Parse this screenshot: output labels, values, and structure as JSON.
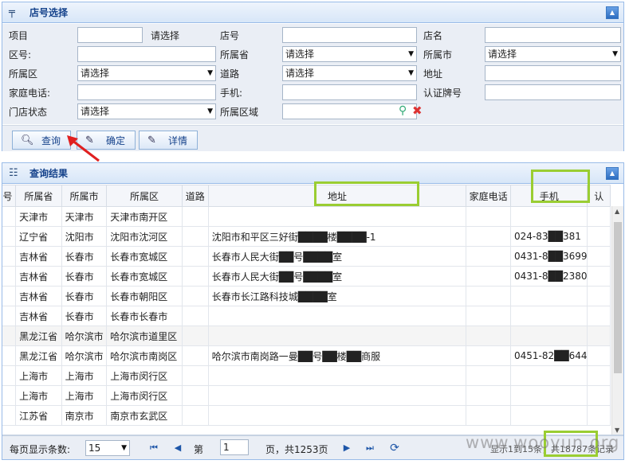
{
  "search_panel": {
    "title": "店号选择",
    "collapse": "▲",
    "fields": {
      "xiangmu_label": "项目",
      "xiangmu_value": "",
      "xiangmu_hint": "请选择",
      "dianhao_label": "店号",
      "dianming_label": "店名",
      "quhao_label": "区号:",
      "suoshusheng_label": "所属省",
      "suoshusheng_value": "请选择",
      "suoshushi_label": "所属市",
      "suoshushi_value": "请选择",
      "suoshuqu_label": "所属区",
      "suoshuqu_value": "请选择",
      "daolu_label": "道路",
      "daolu_value": "请选择",
      "dizhi_label": "地址",
      "jiating_label": "家庭电话:",
      "shouji_label": "手机:",
      "renzheng_label": "认证牌号",
      "mendian_label": "门店状态",
      "mendian_value": "请选择",
      "quyu_label": "所属区域"
    },
    "buttons": {
      "query": "查询",
      "confirm": "确定",
      "detail": "详情"
    }
  },
  "results_panel": {
    "title": "查询结果",
    "collapse": "▲",
    "columns": [
      "区号",
      "所属省",
      "所属市",
      "所属区",
      "道路",
      "地址",
      "家庭电话",
      "手机",
      "认"
    ],
    "rows": [
      [
        "",
        "天津市",
        "天津市",
        "天津市南开区",
        "",
        "",
        "",
        ""
      ],
      [
        "",
        "辽宁省",
        "沈阳市",
        "沈阳市沈河区",
        "",
        "沈阳市和平区三好街████楼████-1",
        "",
        "024-83██381"
      ],
      [
        "",
        "吉林省",
        "长春市",
        "长春市宽城区",
        "",
        "长春市人民大街██号████室",
        "",
        "0431-8██3699"
      ],
      [
        "",
        "吉林省",
        "长春市",
        "长春市宽城区",
        "",
        "长春市人民大街██号████室",
        "",
        "0431-8██2380"
      ],
      [
        "",
        "吉林省",
        "长春市",
        "长春市朝阳区",
        "",
        "长春市长江路科技城████室",
        "",
        ""
      ],
      [
        "",
        "吉林省",
        "长春市",
        "长春市长春市",
        "",
        "",
        "",
        ""
      ],
      [
        "",
        "黑龙江省",
        "哈尔滨市",
        "哈尔滨市道里区",
        "",
        "",
        "",
        ""
      ],
      [
        "",
        "黑龙江省",
        "哈尔滨市",
        "哈尔滨市南岗区",
        "",
        "哈尔滨市南岗路一曼██号██楼██商服",
        "",
        "0451-82██644"
      ],
      [
        "",
        "上海市",
        "上海市",
        "上海市闵行区",
        "",
        "",
        "",
        ""
      ],
      [
        "",
        "上海市",
        "上海市",
        "上海市闵行区",
        "",
        "",
        "",
        ""
      ],
      [
        "",
        "江苏省",
        "南京市",
        "南京市玄武区",
        "",
        "",
        "",
        ""
      ]
    ]
  },
  "pager": {
    "page_size_label": "每页显示条数:",
    "page_size": "15",
    "page_prefix": "第",
    "page_number": "1",
    "page_suffix": "页，共1253页",
    "summary": "显示1到15条，共18787条记录"
  },
  "watermark": "www.wooyun.org"
}
